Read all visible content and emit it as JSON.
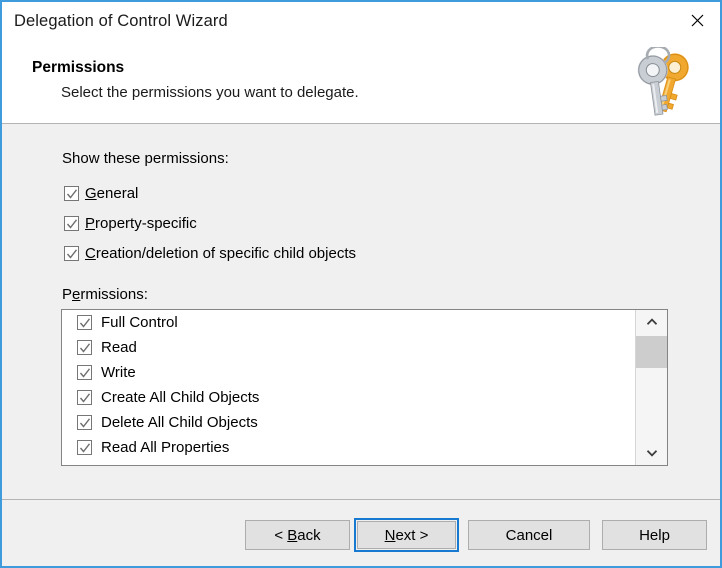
{
  "window": {
    "title": "Delegation of Control Wizard",
    "close_icon": "close-icon",
    "accent_color": "#3f9bdc",
    "body_color": "#f0f0f0"
  },
  "header": {
    "title": "Permissions",
    "subtitle": "Select the permissions you want to delegate.",
    "icon": "keys-icon"
  },
  "main": {
    "show_permissions_label": "Show these permissions:",
    "filter_checkboxes": [
      {
        "label": "General",
        "accel": "G",
        "checked": true
      },
      {
        "label": "Property-specific",
        "accel": "P",
        "checked": true
      },
      {
        "label": "Creation/deletion of specific child objects",
        "accel": "C",
        "checked": true
      }
    ],
    "permissions_label": "Permissions:",
    "permissions_accel": "e",
    "permissions_list": [
      {
        "label": "Full Control",
        "checked": true
      },
      {
        "label": "Read",
        "checked": true
      },
      {
        "label": "Write",
        "checked": true
      },
      {
        "label": "Create All Child Objects",
        "checked": true
      },
      {
        "label": "Delete All Child Objects",
        "checked": true
      },
      {
        "label": "Read All Properties",
        "checked": true
      }
    ],
    "scrollbar": {
      "up_icon": "chevron-up-icon",
      "down_icon": "chevron-down-icon",
      "thumb": "scrollbar-thumb"
    }
  },
  "footer": {
    "back_label": "< Back",
    "back_accel": "B",
    "next_label": "Next >",
    "next_accel": "N",
    "next_focused": true,
    "cancel_label": "Cancel",
    "help_label": "Help"
  }
}
